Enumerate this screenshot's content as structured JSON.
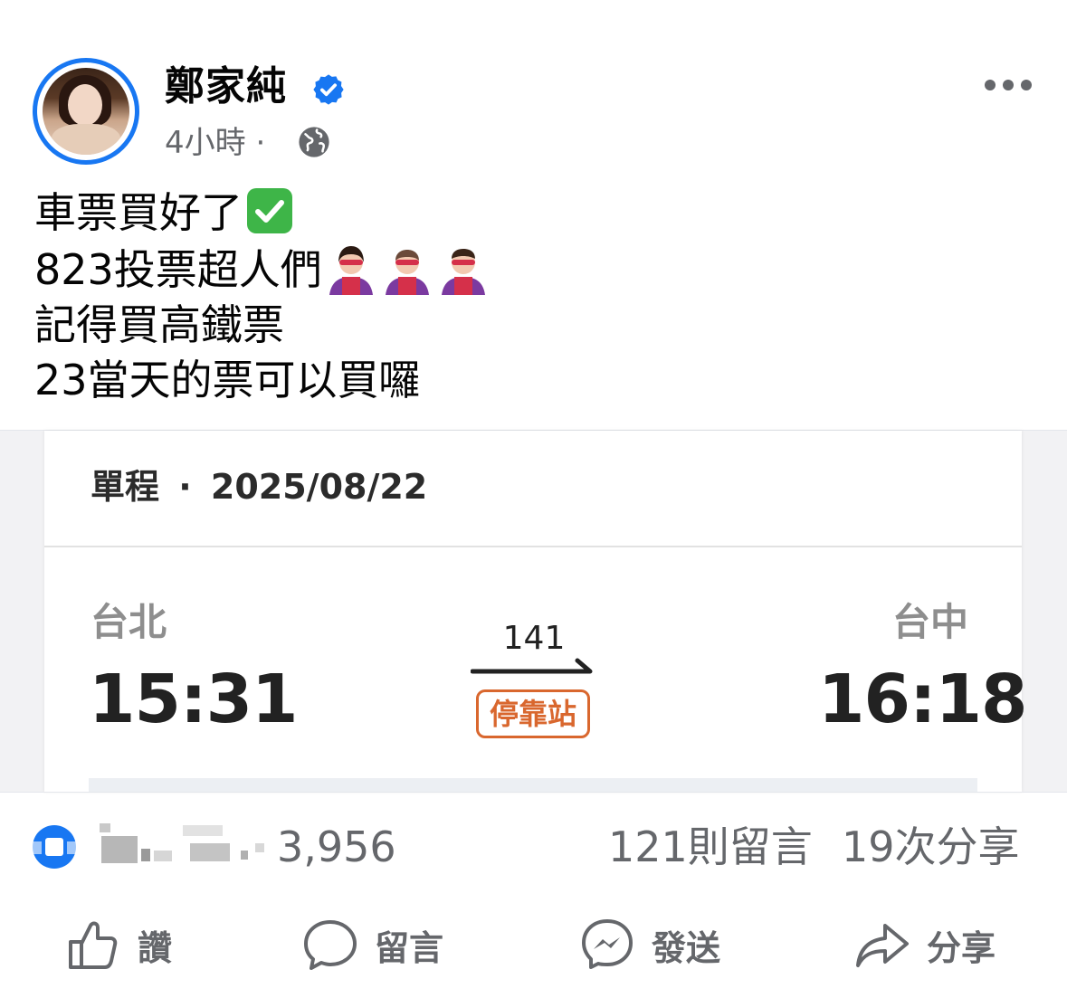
{
  "author": {
    "name": "鄭家純",
    "time": "4小時",
    "separator": "·",
    "audience_icon": "globe-icon",
    "verified_icon": "verified-badge-icon",
    "accent": "#1877f2"
  },
  "post": {
    "lines": [
      "車票買好了",
      "823投票超人們",
      "記得買高鐵票",
      "23當天的票可以買囉"
    ],
    "line1_emoji": "check-mark-button-icon",
    "line2_emoji": "superhero-icons"
  },
  "ticket": {
    "trip_type": "單程",
    "dot": "·",
    "date": "2025/08/22",
    "origin": "台北",
    "destination": "台中",
    "depart_time": "15:31",
    "arrive_time": "16:18",
    "train_number": "141",
    "stop_type": "停靠站",
    "stop_color": "#d9672e"
  },
  "stats": {
    "reaction_count": "3,956",
    "comments": "121則留言",
    "shares": "19次分享"
  },
  "actions": {
    "like": "讚",
    "comment": "留言",
    "send": "發送",
    "share": "分享"
  }
}
